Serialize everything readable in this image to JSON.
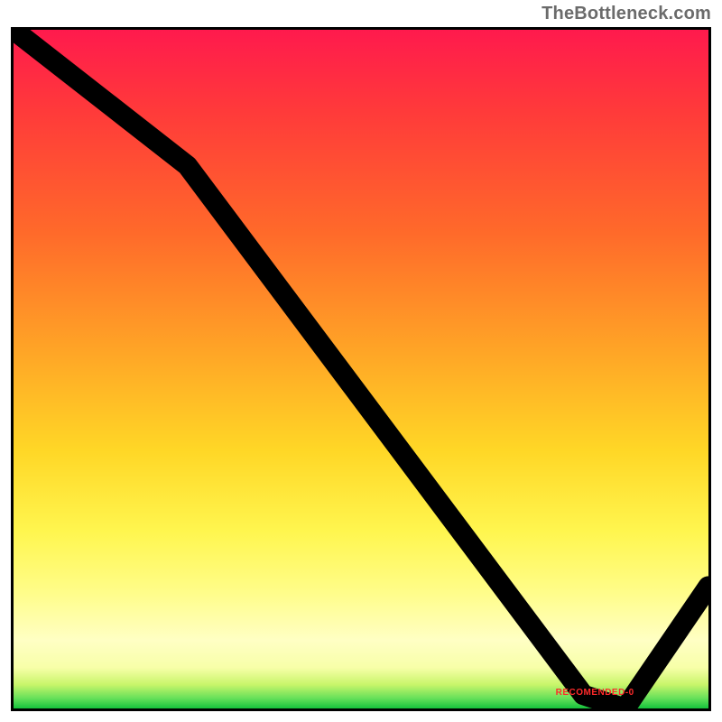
{
  "attribution": "TheBottleneck.com",
  "min_label": "RECOMENDED-0",
  "chart_data": {
    "type": "line",
    "title": "",
    "xlabel": "",
    "ylabel": "",
    "xlim": [
      0,
      100
    ],
    "ylim": [
      0,
      100
    ],
    "categories": [
      0,
      25,
      82,
      88,
      100
    ],
    "values": [
      100,
      80,
      2,
      0,
      18
    ],
    "min_x": 85,
    "gradient_stops": [
      {
        "pct": 0,
        "color": "#ff1a4d"
      },
      {
        "pct": 30,
        "color": "#ff6a2a"
      },
      {
        "pct": 62,
        "color": "#ffd726"
      },
      {
        "pct": 90,
        "color": "#ffffc4"
      },
      {
        "pct": 100,
        "color": "#15c23c"
      }
    ]
  }
}
